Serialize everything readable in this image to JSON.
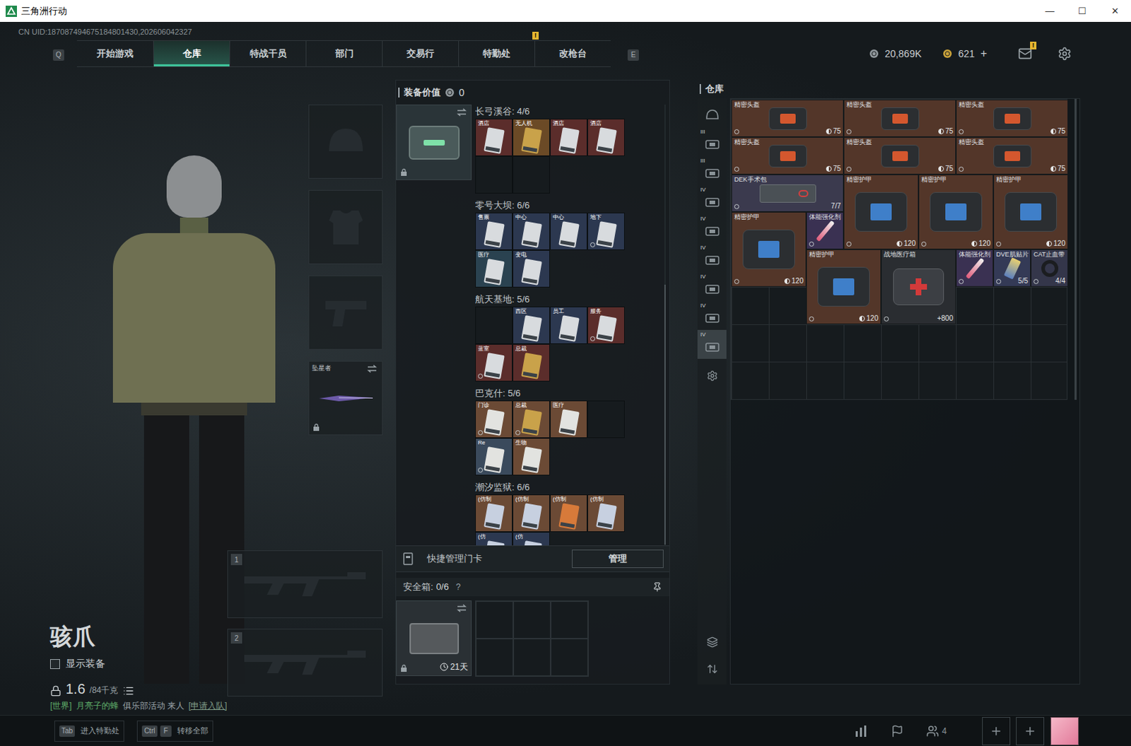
{
  "window": {
    "title": "三角洲行动",
    "controls": [
      "—",
      "☐",
      "✕"
    ]
  },
  "uid": "CN UID:187087494675184801430,202606042327",
  "nav": {
    "left_key": "Q",
    "right_key": "E",
    "tabs": [
      {
        "label": "开始游戏",
        "selected": false,
        "badge": ""
      },
      {
        "label": "仓库",
        "selected": true,
        "badge": ""
      },
      {
        "label": "特战干员",
        "selected": false,
        "badge": ""
      },
      {
        "label": "部门",
        "selected": false,
        "badge": ""
      },
      {
        "label": "交易行",
        "selected": false,
        "badge": ""
      },
      {
        "label": "特勤处",
        "selected": false,
        "badge": "!"
      },
      {
        "label": "改枪台",
        "selected": false,
        "badge": ""
      }
    ]
  },
  "currency": {
    "coins": "20,869K",
    "bonds": "621",
    "add": "+"
  },
  "mail": {
    "badge": "!"
  },
  "operator": {
    "name": "骇爪",
    "show_gear": {
      "label": "显示装备",
      "checked": false
    },
    "weight": "1.6",
    "capacity": "/84千克"
  },
  "chat": {
    "channel": "[世界]",
    "sender": "月亮子的蜂",
    "text": "俱乐部活动 来人",
    "action": "[申请入队]"
  },
  "gear_slots": [
    {
      "kind": "helmet",
      "label": "",
      "locked": false
    },
    {
      "kind": "armor",
      "label": "",
      "locked": false
    },
    {
      "kind": "pistol",
      "label": "",
      "locked": false
    },
    {
      "kind": "melee",
      "label": "坠星者",
      "locked": true
    }
  ],
  "weapon_slots": [
    "1",
    "2"
  ],
  "loadout": {
    "title": "装备价值",
    "value": "0",
    "case_locked": true,
    "sections": [
      {
        "title": "长弓溪谷: 4/6",
        "cards": [
          {
            "label": "酒店",
            "empty": false,
            "bound": false,
            "color": "#5b2d2b",
            "card": "#d8dbde"
          },
          {
            "label": "无人机",
            "empty": false,
            "bound": false,
            "color": "#6b4a26",
            "card": "#c9a24a"
          },
          {
            "label": "酒店",
            "empty": false,
            "bound": false,
            "color": "#5b2d2b",
            "card": "#d8dbde"
          },
          {
            "label": "酒店",
            "empty": false,
            "bound": false,
            "color": "#5b2d2b",
            "card": "#d8dbde"
          },
          {
            "label": "",
            "empty": true,
            "bound": false,
            "color": "#161b1e",
            "card": "#161b1e"
          },
          {
            "label": "",
            "empty": true,
            "bound": false,
            "color": "#161b1e",
            "card": "#161b1e"
          }
        ]
      },
      {
        "title": "零号大坝: 6/6",
        "cards": [
          {
            "label": "售票",
            "empty": false,
            "bound": false,
            "color": "#2c3850",
            "card": "#d8dbde"
          },
          {
            "label": "中心",
            "empty": false,
            "bound": false,
            "color": "#2c3850",
            "card": "#d8dbde"
          },
          {
            "label": "中心",
            "empty": false,
            "bound": false,
            "color": "#2c3850",
            "card": "#d8dbde"
          },
          {
            "label": "地下",
            "empty": false,
            "bound": true,
            "color": "#2c3850",
            "card": "#d8dbde"
          },
          {
            "label": "医疗",
            "empty": false,
            "bound": false,
            "color": "#2a4250",
            "card": "#d8dbde"
          },
          {
            "label": "变电",
            "empty": false,
            "bound": false,
            "color": "#2c3850",
            "card": "#d8dbde"
          }
        ]
      },
      {
        "title": "航天基地: 5/6",
        "cards": [
          {
            "label": "",
            "empty": true,
            "bound": false,
            "color": "#161b1e",
            "card": "#161b1e"
          },
          {
            "label": "西区",
            "empty": false,
            "bound": false,
            "color": "#2c3850",
            "card": "#d8dbde"
          },
          {
            "label": "员工",
            "empty": false,
            "bound": false,
            "color": "#2c3850",
            "card": "#d8dbde"
          },
          {
            "label": "服务",
            "empty": false,
            "bound": true,
            "color": "#5b2d2b",
            "card": "#d8dbde"
          },
          {
            "label": "蓝室",
            "empty": false,
            "bound": true,
            "color": "#5b2d2b",
            "card": "#d8dbde"
          },
          {
            "label": "总裁",
            "empty": false,
            "bound": false,
            "color": "#5b2d2b",
            "card": "#c9a24a"
          }
        ]
      },
      {
        "title": "巴克什: 5/6",
        "cards": [
          {
            "label": "门诊",
            "empty": false,
            "bound": true,
            "color": "#6b4a35",
            "card": "#e2e3e0"
          },
          {
            "label": "总裁",
            "empty": false,
            "bound": true,
            "color": "#6b4a35",
            "card": "#c9a24a"
          },
          {
            "label": "医疗",
            "empty": false,
            "bound": false,
            "color": "#6b4a35",
            "card": "#e2e3e0"
          },
          {
            "label": "",
            "empty": true,
            "bound": false,
            "color": "#161b1e",
            "card": "#161b1e"
          },
          {
            "label": "Re",
            "empty": false,
            "bound": true,
            "color": "#3a4a5c",
            "card": "#e2e3e0"
          },
          {
            "label": "生物",
            "empty": false,
            "bound": false,
            "color": "#6b4a35",
            "card": "#e2e3e0"
          }
        ]
      },
      {
        "title": "潮汐监狱: 6/6",
        "cards": [
          {
            "label": "(仿制",
            "empty": false,
            "bound": false,
            "color": "#6b4a35",
            "card": "#c7d0e0"
          },
          {
            "label": "(仿制",
            "empty": false,
            "bound": false,
            "color": "#6b4a35",
            "card": "#c7d0e0"
          },
          {
            "label": "(仿制",
            "empty": false,
            "bound": false,
            "color": "#6b4a35",
            "card": "#d77a3a"
          },
          {
            "label": "(仿制",
            "empty": false,
            "bound": false,
            "color": "#6b4a35",
            "card": "#c7d0e0"
          },
          {
            "label": "(仿",
            "empty": false,
            "bound": false,
            "color": "#2c3850",
            "card": "#c7d0e0"
          },
          {
            "label": "(仿",
            "empty": false,
            "bound": false,
            "color": "#2c3850",
            "card": "#c7d0e0"
          }
        ]
      }
    ]
  },
  "keycards": {
    "manage_label": "快捷管理门卡",
    "manage_button": "管理"
  },
  "safe_box": {
    "title": "安全箱:",
    "count": "0/6",
    "help": "?",
    "days": "21天",
    "slots": 6,
    "locked": true
  },
  "warehouse": {
    "title": "仓库",
    "categories": [
      {
        "label": "",
        "kind": "helmet",
        "selected": false
      },
      {
        "label": "III",
        "kind": "box",
        "selected": false
      },
      {
        "label": "III",
        "kind": "box",
        "selected": false
      },
      {
        "label": "IV",
        "kind": "box",
        "selected": false
      },
      {
        "label": "IV",
        "kind": "box",
        "selected": false
      },
      {
        "label": "IV",
        "kind": "box",
        "selected": false
      },
      {
        "label": "IV",
        "kind": "box",
        "selected": false
      },
      {
        "label": "IV",
        "kind": "box",
        "selected": false
      },
      {
        "label": "IV",
        "kind": "box",
        "selected": true
      },
      {
        "label": "",
        "kind": "gear",
        "selected": false
      }
    ],
    "items": [
      {
        "name": "精密头盔",
        "kind": "helmet",
        "value": "75",
        "durability": true,
        "bound": true,
        "color": "#533629"
      },
      {
        "name": "精密头盔",
        "kind": "helmet",
        "value": "75",
        "durability": true,
        "bound": true,
        "color": "#533629"
      },
      {
        "name": "精密头盔",
        "kind": "helmet",
        "value": "75",
        "durability": true,
        "bound": true,
        "color": "#533629"
      },
      {
        "name": "精密头盔",
        "kind": "helmet",
        "value": "75",
        "durability": true,
        "bound": true,
        "color": "#533629"
      },
      {
        "name": "精密头盔",
        "kind": "helmet",
        "value": "75",
        "durability": true,
        "bound": true,
        "color": "#533629"
      },
      {
        "name": "精密头盔",
        "kind": "helmet",
        "value": "75",
        "durability": true,
        "bound": true,
        "color": "#533629"
      },
      {
        "name": "DEK手术包",
        "kind": "kit",
        "value": "7/7",
        "durability": false,
        "bound": true,
        "color": "#3b3a4e"
      },
      {
        "name": "精密护甲",
        "kind": "armor",
        "value": "120",
        "durability": true,
        "bound": true,
        "color": "#533629"
      },
      {
        "name": "精密护甲",
        "kind": "armor",
        "value": "120",
        "durability": true,
        "bound": true,
        "color": "#533629"
      },
      {
        "name": "精密护甲",
        "kind": "armor",
        "value": "120",
        "durability": true,
        "bound": true,
        "color": "#533629"
      },
      {
        "name": "精密护甲",
        "kind": "armor",
        "value": "120",
        "durability": true,
        "bound": true,
        "color": "#533629"
      },
      {
        "name": "体能强化剂",
        "kind": "syringe",
        "value": "",
        "durability": false,
        "bound": true,
        "color": "#3a3152"
      },
      {
        "name": "精密护甲",
        "kind": "armor",
        "value": "120",
        "durability": true,
        "bound": true,
        "color": "#533629"
      },
      {
        "name": "战地医疗箱",
        "kind": "medkit",
        "value": "+800",
        "durability": false,
        "bound": true,
        "color": "#2a2d31"
      },
      {
        "name": "体能强化剂",
        "kind": "syringe",
        "value": "",
        "durability": false,
        "bound": true,
        "color": "#3a3152"
      },
      {
        "name": "DVE肌贴片",
        "kind": "patch",
        "value": "5/5",
        "durability": false,
        "bound": true,
        "color": "#343a56"
      },
      {
        "name": "CAT止血带",
        "kind": "tourniquet",
        "value": "4/4",
        "durability": false,
        "bound": true,
        "color": "#34364a"
      }
    ]
  },
  "bottom_bar": {
    "shortcuts": [
      {
        "keys": [
          "Tab"
        ],
        "label": "进入特勤处"
      },
      {
        "keys": [
          "Ctrl",
          "F"
        ],
        "label": "转移全部"
      }
    ],
    "party_count": "4"
  }
}
